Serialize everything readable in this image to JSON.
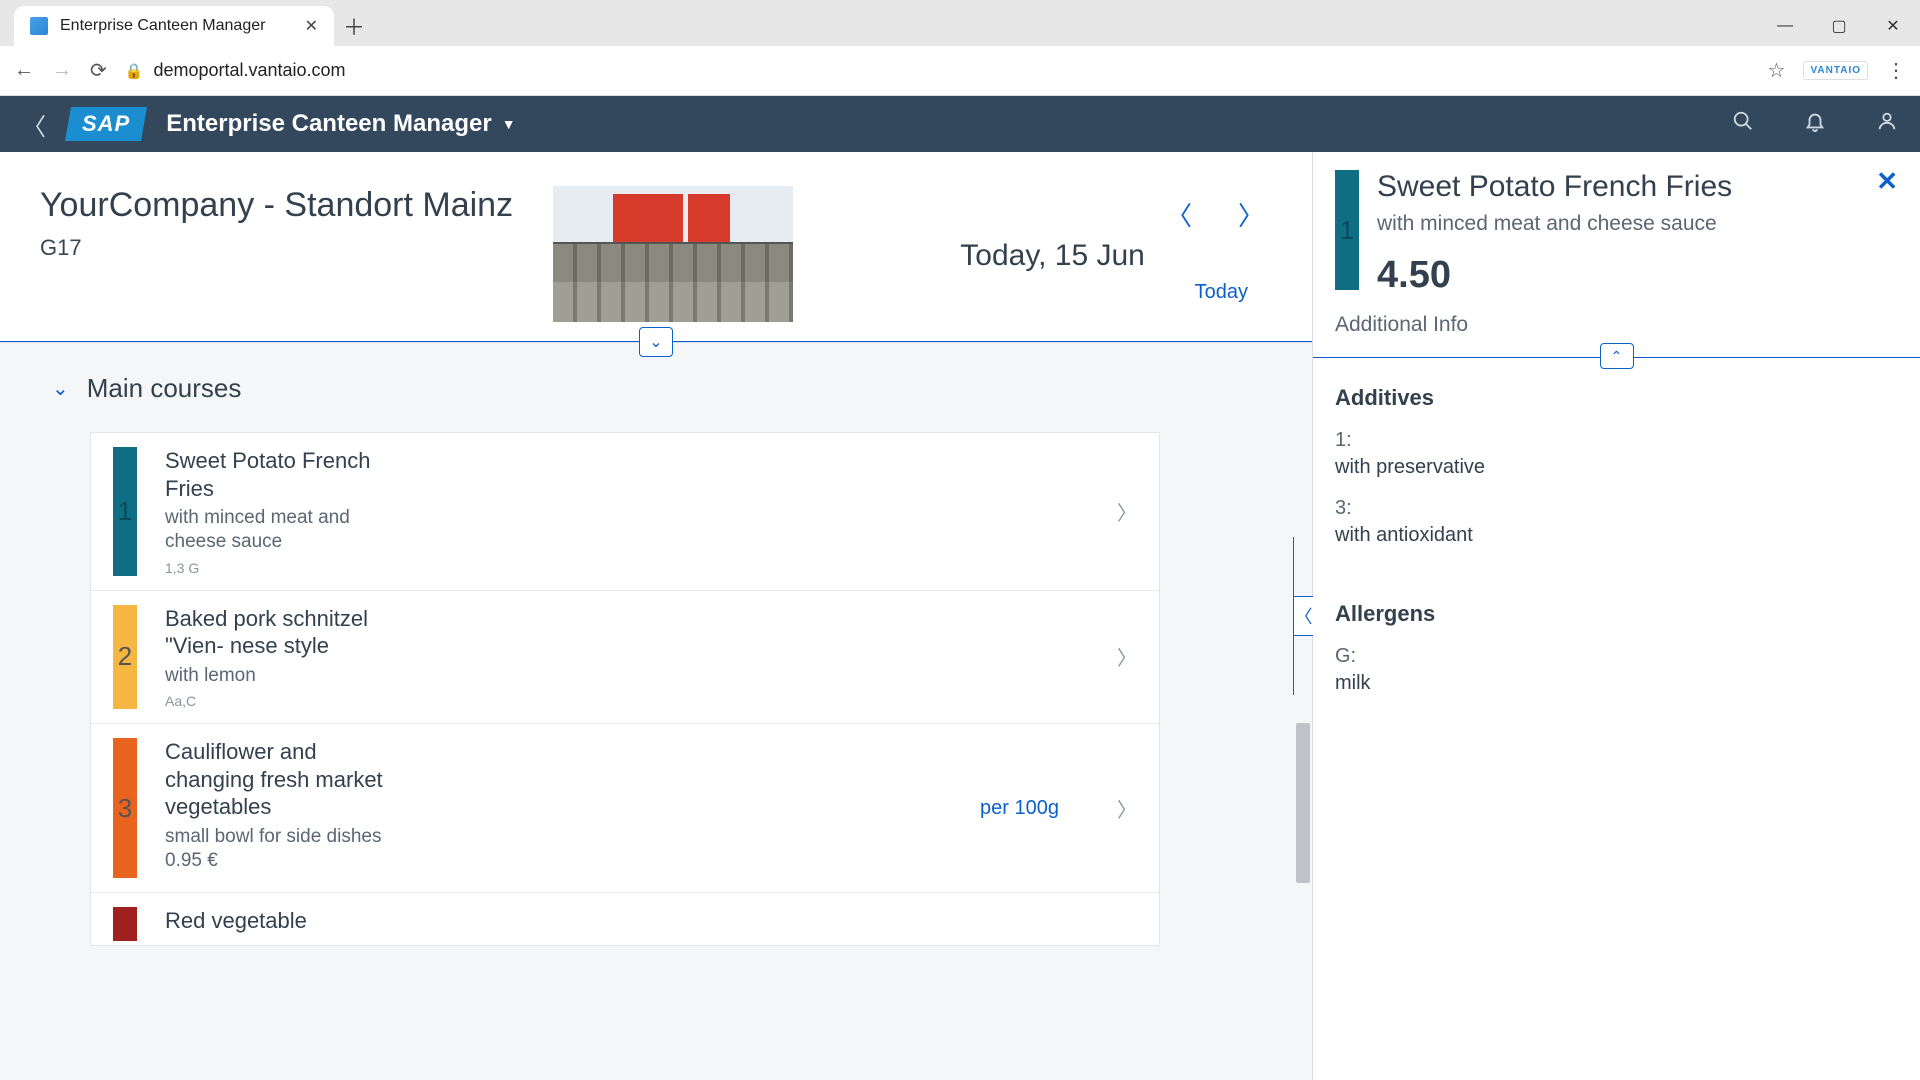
{
  "browser": {
    "tab_title": "Enterprise Canteen Manager",
    "url": "demoportal.vantaio.com",
    "brand_badge": "VANTAIO"
  },
  "header": {
    "logo_text": "SAP",
    "app_title": "Enterprise Canteen Manager"
  },
  "location": {
    "name": "YourCompany - Standort Mainz",
    "code": "G17",
    "date_label": "Today, 15 Jun",
    "today_link": "Today"
  },
  "section": {
    "title": "Main courses"
  },
  "items": [
    {
      "num": "1",
      "color": "#0f6e84",
      "title": "Sweet Potato French Fries",
      "sub": "with minced meat and cheese sauce",
      "tags": "1,3 G",
      "extra": ""
    },
    {
      "num": "2",
      "color": "#f5b742",
      "title": "Baked pork schnitzel \"Vien- nese style",
      "sub": "with lemon",
      "tags": "Aa,C",
      "extra": ""
    },
    {
      "num": "3",
      "color": "#e8641e",
      "title": "Cauliflower and changing fresh market vegetables",
      "sub": "small bowl for side dishes 0.95 €",
      "tags": "",
      "extra": "per 100g"
    },
    {
      "num": "",
      "color": "#a02020",
      "title": "Red vegetable",
      "sub": "",
      "tags": "",
      "extra": ""
    }
  ],
  "detail": {
    "num": "1",
    "title": "Sweet Potato French Fries",
    "sub": "with minced meat and cheese sauce",
    "price": "4.50",
    "additional_info_label": "Additional Info",
    "additives_label": "Additives",
    "additives": [
      {
        "k": "1:",
        "v": "with preservative"
      },
      {
        "k": "3:",
        "v": "with antioxidant"
      }
    ],
    "allergens_label": "Allergens",
    "allergens": [
      {
        "k": "G:",
        "v": "milk"
      }
    ]
  }
}
